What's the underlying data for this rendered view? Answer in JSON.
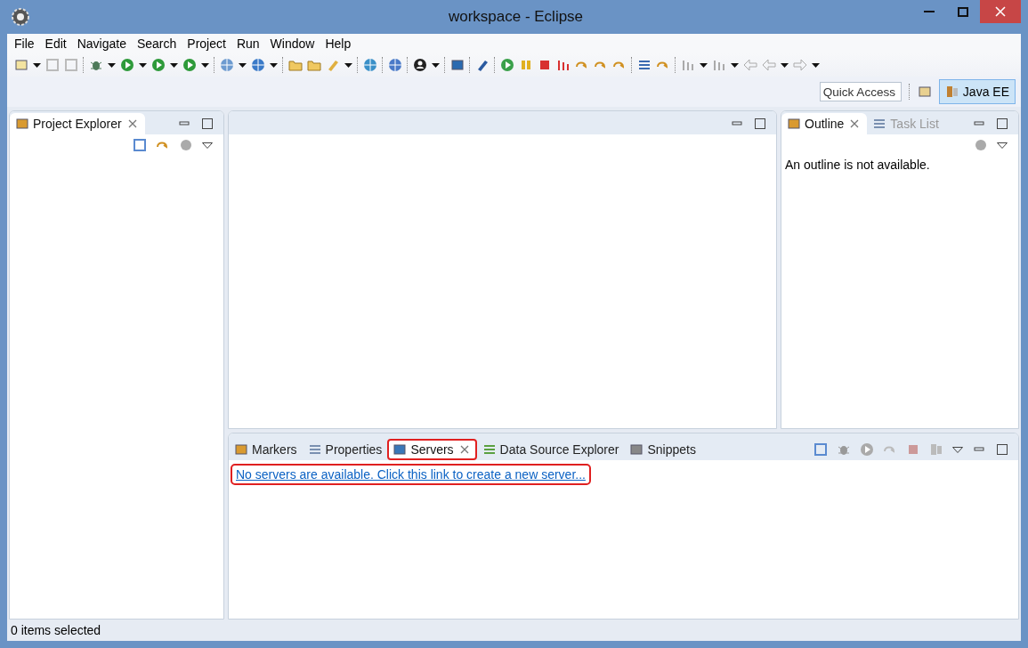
{
  "window": {
    "title": "workspace - Eclipse"
  },
  "menu": [
    "File",
    "Edit",
    "Navigate",
    "Search",
    "Project",
    "Run",
    "Window",
    "Help"
  ],
  "quick_access": {
    "placeholder": "Quick Access"
  },
  "perspectives": [
    {
      "label": "Java EE",
      "selected": true
    }
  ],
  "left_panel": {
    "tabs": [
      {
        "label": "Project Explorer",
        "selected": true,
        "closable": true
      }
    ]
  },
  "outline_panel": {
    "tabs": [
      {
        "label": "Outline",
        "selected": true,
        "closable": true
      },
      {
        "label": "Task List",
        "selected": false,
        "closable": false
      }
    ],
    "message": "An outline is not available."
  },
  "bottom_panel": {
    "tabs": [
      {
        "label": "Markers",
        "selected": false,
        "closable": false,
        "highlighted": false
      },
      {
        "label": "Properties",
        "selected": false,
        "closable": false,
        "highlighted": false
      },
      {
        "label": "Servers",
        "selected": true,
        "closable": true,
        "highlighted": true
      },
      {
        "label": "Data Source Explorer",
        "selected": false,
        "closable": false,
        "highlighted": false
      },
      {
        "label": "Snippets",
        "selected": false,
        "closable": false,
        "highlighted": false
      }
    ],
    "link": {
      "text": "No servers are available. Click this link to create a new server...",
      "highlighted": true
    }
  },
  "status_bar": {
    "text": "0 items selected"
  }
}
